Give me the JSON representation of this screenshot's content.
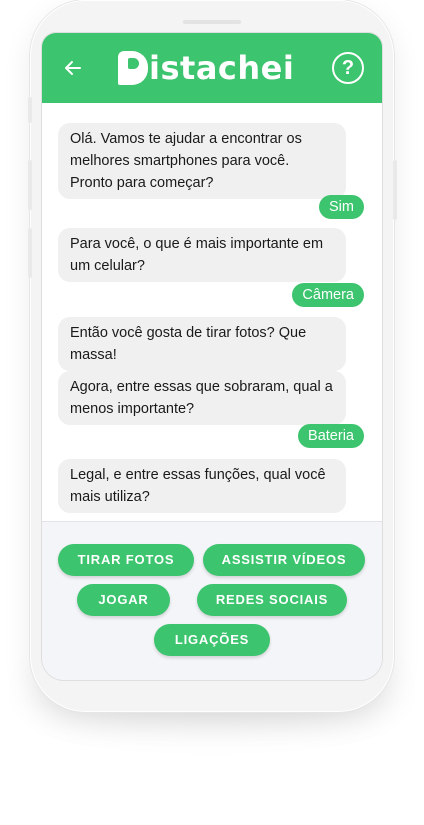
{
  "header": {
    "back_icon": "arrow-left-icon",
    "logo_text": "istachei",
    "logo_full": "Pistachei",
    "help_symbol": "?",
    "help_icon": "question-circle-icon",
    "color": "#3cc46e"
  },
  "chat": {
    "messages": [
      {
        "from": "bot",
        "text": "Olá. Vamos te ajudar a encontrar os melhores smartphones para você. Pronto para começar?"
      },
      {
        "from": "user",
        "text": "Sim"
      },
      {
        "from": "bot",
        "text": "Para você, o que é mais importante em um celular?"
      },
      {
        "from": "user",
        "text": "Câmera"
      },
      {
        "from": "bot",
        "text": "Então você gosta de tirar fotos? Que massa!"
      },
      {
        "from": "bot",
        "text": "Agora, entre essas que sobraram, qual a menos importante?"
      },
      {
        "from": "user",
        "text": "Bateria"
      },
      {
        "from": "bot",
        "text": "Legal, e entre essas funções, qual você mais utiliza?"
      }
    ]
  },
  "options": [
    {
      "label": "TIRAR FOTOS"
    },
    {
      "label": "ASSISTIR VÍDEOS"
    },
    {
      "label": "JOGAR"
    },
    {
      "label": "REDES SOCIAIS"
    },
    {
      "label": "LIGAÇÕES"
    }
  ]
}
